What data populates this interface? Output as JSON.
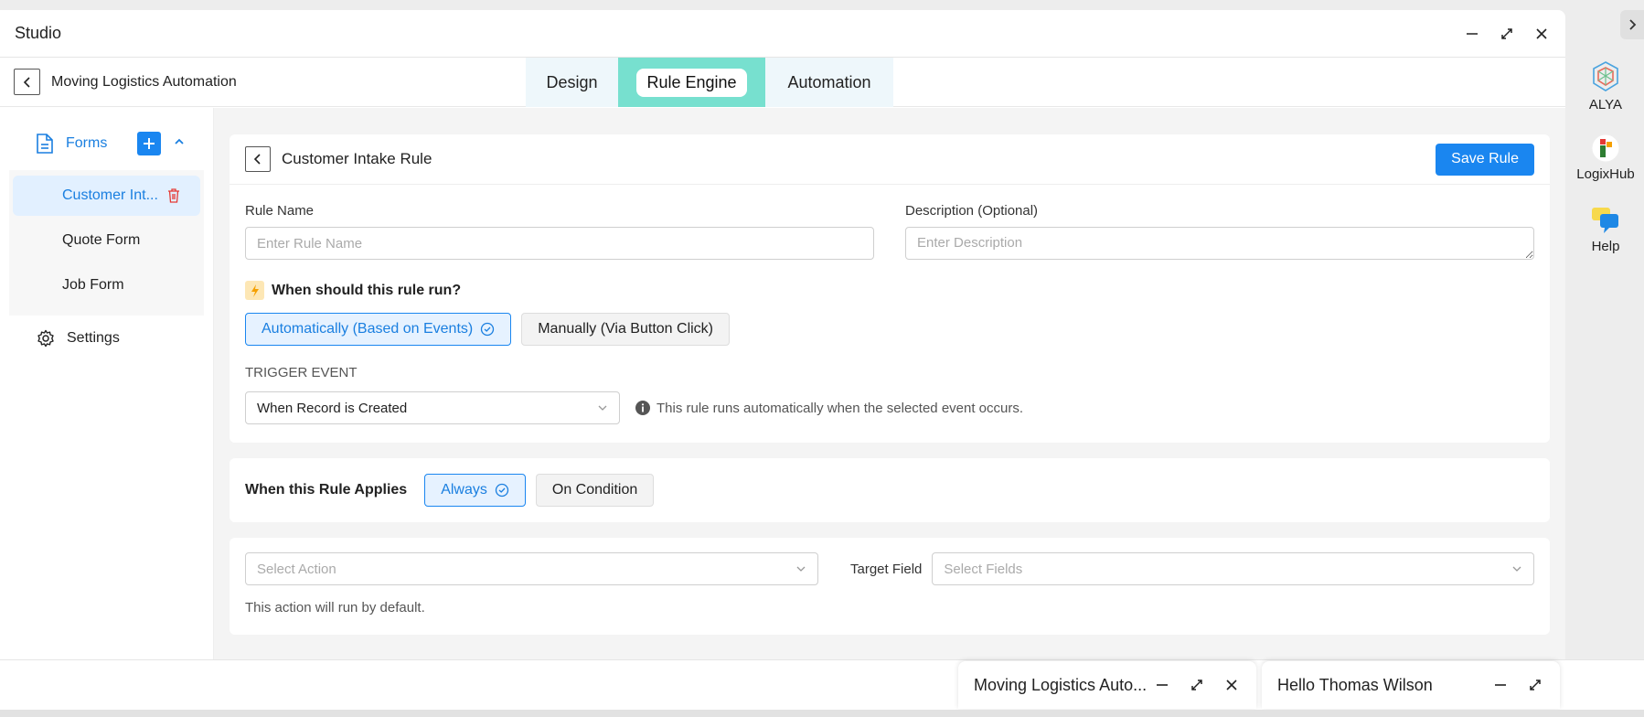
{
  "window": {
    "title": "Studio"
  },
  "nav": {
    "project_name": "Moving Logistics Automation",
    "tabs": [
      {
        "label": "Design"
      },
      {
        "label": "Rule Engine"
      },
      {
        "label": "Automation"
      }
    ]
  },
  "sidebar": {
    "forms_label": "Forms",
    "items": [
      {
        "label": "Customer Int..."
      },
      {
        "label": "Quote Form"
      },
      {
        "label": "Job Form"
      }
    ],
    "settings_label": "Settings"
  },
  "rule": {
    "title": "Customer Intake Rule",
    "save_label": "Save Rule",
    "name_label": "Rule Name",
    "name_placeholder": "Enter Rule Name",
    "desc_label": "Description (Optional)",
    "desc_placeholder": "Enter Description",
    "when_question": "When should this rule run?",
    "run_options": [
      {
        "label": "Automatically (Based on Events)"
      },
      {
        "label": "Manually (Via Button Click)"
      }
    ],
    "trigger_label": "TRIGGER EVENT",
    "trigger_value": "When Record is Created",
    "trigger_note": "This rule runs automatically when the selected event occurs."
  },
  "applies": {
    "label": "When this Rule Applies",
    "options": [
      {
        "label": "Always"
      },
      {
        "label": "On Condition"
      }
    ]
  },
  "action": {
    "select_placeholder": "Select Action",
    "target_label": "Target Field",
    "fields_placeholder": "Select Fields",
    "default_note": "This action will run by default."
  },
  "taskbar": {
    "windows": [
      {
        "label": "Moving Logistics Auto..."
      },
      {
        "label": "Hello Thomas Wilson"
      }
    ]
  },
  "dock": {
    "apps": [
      {
        "label": "ALYA"
      },
      {
        "label": "LogixHub"
      },
      {
        "label": "Help"
      }
    ]
  },
  "colors": {
    "accent": "#1a86f0",
    "tab_active": "#77e0cf",
    "delete": "#e53935"
  }
}
